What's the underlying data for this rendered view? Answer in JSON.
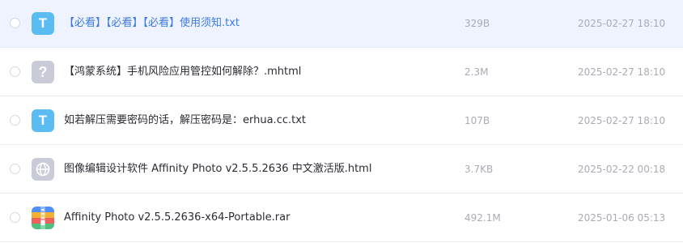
{
  "files": [
    {
      "icon": "txt-file-icon",
      "icon_glyph": "T",
      "name": "【必看】【必看】【必看】使用须知.txt",
      "size": "329B",
      "date": "2025-02-27 18:10",
      "selected": true
    },
    {
      "icon": "unknown-file-icon",
      "icon_glyph": "?",
      "name": "【鸿蒙系统】手机风险应用管控如何解除？.mhtml",
      "size": "2.3M",
      "date": "2025-02-27 18:10",
      "selected": false
    },
    {
      "icon": "txt-file-icon",
      "icon_glyph": "T",
      "name": "如若解压需要密码的话，解压密码是：erhua.cc.txt",
      "size": "107B",
      "date": "2025-02-27 18:10",
      "selected": false
    },
    {
      "icon": "web-file-icon",
      "icon_glyph": "",
      "name": "图像编辑设计软件 Affinity Photo v2.5.5.2636 中文激活版.html",
      "size": "3.7KB",
      "date": "2025-02-22 00:18",
      "selected": false
    },
    {
      "icon": "archive-file-icon",
      "icon_glyph": "",
      "name": "Affinity Photo v2.5.5.2636-x64-Portable.rar",
      "size": "492.1M",
      "date": "2025-01-06 05:13",
      "selected": false
    }
  ],
  "colors": {
    "selected_row_bg": "#eef3ff",
    "selected_name": "#3c7ae3",
    "txt_icon": "#5bbcf2",
    "meta_text": "#a9acb4"
  }
}
